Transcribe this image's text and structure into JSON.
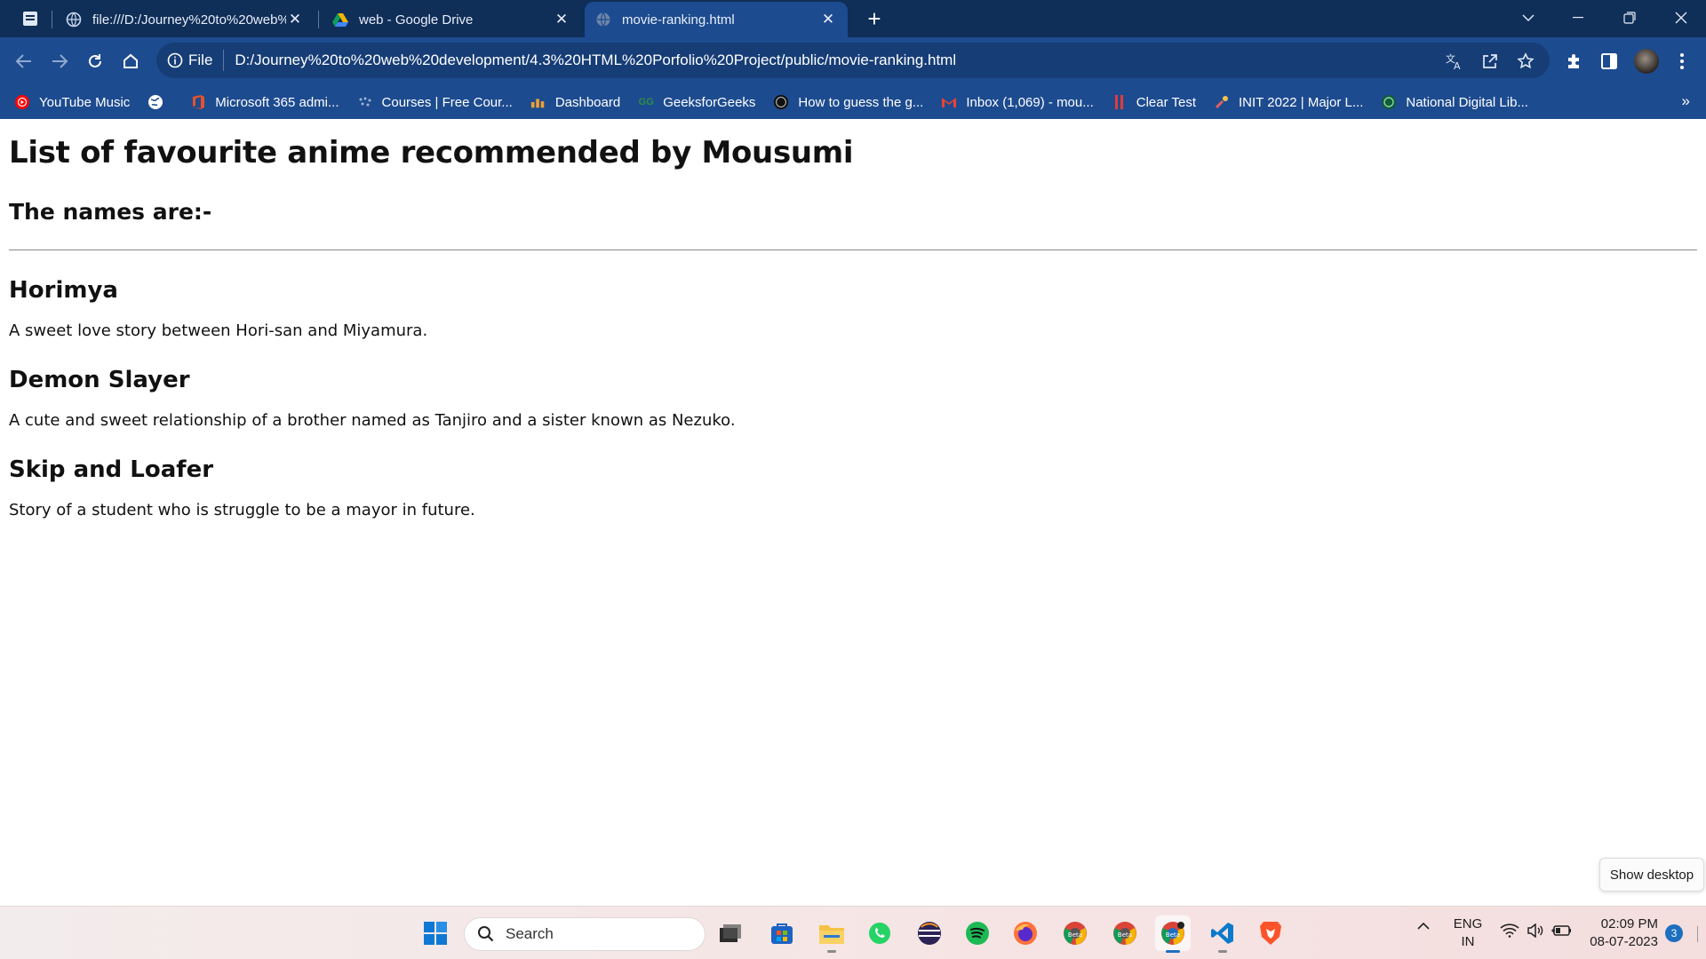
{
  "browser": {
    "tabs": [
      {
        "title": "file:///D:/Journey%20to%20web%",
        "icon": "globe-icon"
      },
      {
        "title": "web - Google Drive",
        "icon": "google-drive-icon"
      },
      {
        "title": "movie-ranking.html",
        "icon": "globe-icon",
        "active": true
      }
    ],
    "address": {
      "scheme_label": "File",
      "url": "D:/Journey%20to%20web%20development/4.3%20HTML%20Porfolio%20Project/public/movie-ranking.html"
    },
    "bookmarks": [
      {
        "label": "YouTube Music",
        "icon": "youtube-music-icon"
      },
      {
        "label": "",
        "icon": "globe-icon"
      },
      {
        "label": "Microsoft 365 admi...",
        "icon": "office-icon"
      },
      {
        "label": "Courses | Free Cour...",
        "icon": "courses-icon"
      },
      {
        "label": "Dashboard",
        "icon": "dashboard-icon"
      },
      {
        "label": "GeeksforGeeks",
        "icon": "geeksforgeeks-icon"
      },
      {
        "label": "How to guess the g...",
        "icon": "site-icon"
      },
      {
        "label": "Inbox (1,069) - mou...",
        "icon": "gmail-icon"
      },
      {
        "label": "Clear Test",
        "icon": "cleartest-icon"
      },
      {
        "label": "INIT 2022 | Major L...",
        "icon": "init-icon"
      },
      {
        "label": "National Digital Lib...",
        "icon": "ndl-icon"
      }
    ],
    "more_bookmarks": "»"
  },
  "page": {
    "title": "List of favourite anime recommended by Mousumi",
    "subtitle": "The names are:-",
    "items": [
      {
        "name": "Horimya",
        "description": "A sweet love story between Hori-san and Miyamura."
      },
      {
        "name": "Demon Slayer",
        "description": "A cute and sweet relationship of a brother named as Tanjiro and a sister known as Nezuko."
      },
      {
        "name": "Skip and Loafer",
        "description": "Story of a student who is struggle to be a mayor in future."
      }
    ]
  },
  "tooltip": {
    "show_desktop": "Show desktop"
  },
  "taskbar": {
    "search_placeholder": "Search",
    "language": {
      "line1": "ENG",
      "line2": "IN"
    },
    "clock": {
      "time": "02:09 PM",
      "date": "08-07-2023"
    },
    "notifications": "3",
    "colors": {
      "accent": "#1d4b8f",
      "tabstrip": "#0f2e58"
    }
  }
}
